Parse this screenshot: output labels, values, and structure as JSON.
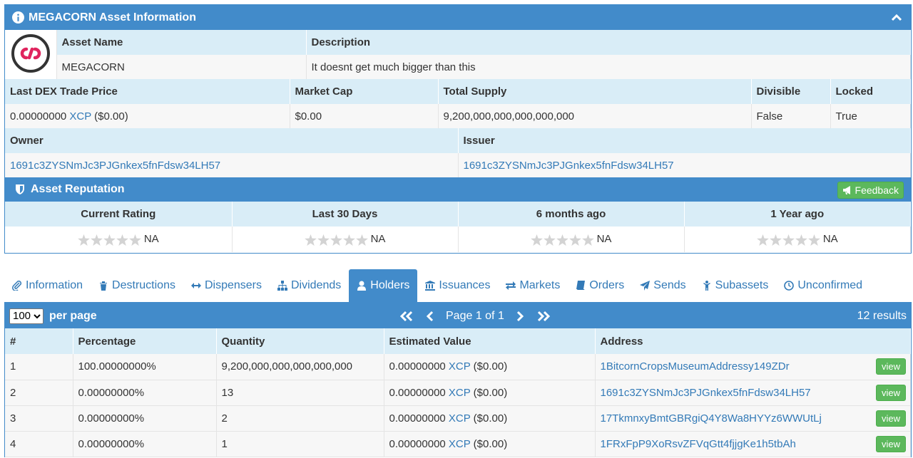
{
  "panel": {
    "title": "MEGACORN Asset Information",
    "asset_name_label": "Asset Name",
    "description_label": "Description",
    "asset_name": "MEGACORN",
    "description": "It doesnt get much bigger than this",
    "price_label": "Last DEX Trade Price",
    "market_cap_label": "Market Cap",
    "supply_label": "Total Supply",
    "divisible_label": "Divisible",
    "locked_label": "Locked",
    "price_value": "0.00000000",
    "price_unit": "XCP",
    "price_usd": "($0.00)",
    "market_cap": "$0.00",
    "supply": "9,200,000,000,000,000,000",
    "divisible": "False",
    "locked": "True",
    "owner_label": "Owner",
    "issuer_label": "Issuer",
    "owner": "1691c3ZYSNmJc3PJGnkex5fnFdsw34LH57",
    "issuer": "1691c3ZYSNmJc3PJGnkex5fnFdsw34LH57"
  },
  "reputation": {
    "title": "Asset Reputation",
    "feedback_label": "Feedback",
    "columns": [
      "Current Rating",
      "Last 30 Days",
      "6 months ago",
      "1 Year ago"
    ],
    "ratings": [
      "NA",
      "NA",
      "NA",
      "NA"
    ]
  },
  "tabs": [
    "Information",
    "Destructions",
    "Dispensers",
    "Dividends",
    "Holders",
    "Issuances",
    "Markets",
    "Orders",
    "Sends",
    "Subassets",
    "Unconfirmed"
  ],
  "pager": {
    "per_page_value": "100",
    "per_page_label": "per page",
    "page_text": "Page 1 of 1",
    "results": "12 results"
  },
  "holders": {
    "headers": [
      "#",
      "Percentage",
      "Quantity",
      "Estimated Value",
      "Address"
    ],
    "view_label": "view",
    "rows": [
      {
        "n": "1",
        "pct": "100.00000000%",
        "qty": "9,200,000,000,000,000,000",
        "value": "0.00000000",
        "unit": "XCP",
        "usd": "($0.00)",
        "address": "1BitcornCropsMuseumAddressy149ZDr"
      },
      {
        "n": "2",
        "pct": "0.00000000%",
        "qty": "13",
        "value": "0.00000000",
        "unit": "XCP",
        "usd": "($0.00)",
        "address": "1691c3ZYSNmJc3PJGnkex5fnFdsw34LH57"
      },
      {
        "n": "3",
        "pct": "0.00000000%",
        "qty": "2",
        "value": "0.00000000",
        "unit": "XCP",
        "usd": "($0.00)",
        "address": "17TkmnxyBmtGBRgiQ4Y8Wa8HYYz6WWUtLj"
      },
      {
        "n": "4",
        "pct": "0.00000000%",
        "qty": "1",
        "value": "0.00000000",
        "unit": "XCP",
        "usd": "($0.00)",
        "address": "1FRxFpP9XoRsvZFVqGtt4fjjgKe1h5tbAh"
      }
    ]
  }
}
